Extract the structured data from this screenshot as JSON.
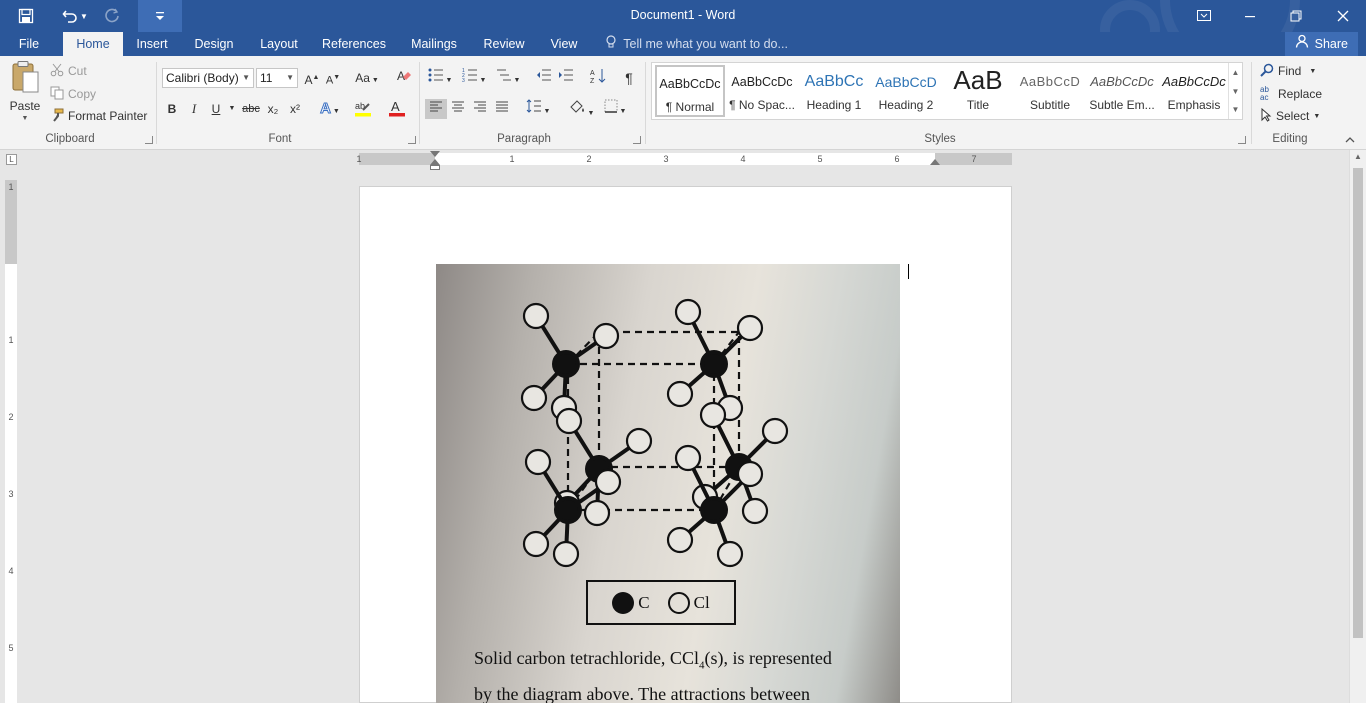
{
  "title_bar": {
    "title": "Document1 - Word"
  },
  "tabs": {
    "file": "File",
    "items": [
      "Home",
      "Insert",
      "Design",
      "Layout",
      "References",
      "Mailings",
      "Review",
      "View"
    ],
    "active": "Home",
    "tell_me": "Tell me what you want to do...",
    "share": "Share"
  },
  "clipboard": {
    "paste": "Paste",
    "cut": "Cut",
    "copy": "Copy",
    "format_painter": "Format Painter",
    "label": "Clipboard"
  },
  "font": {
    "name": "Calibri (Body)",
    "size": "11",
    "label": "Font",
    "bold": "B",
    "italic": "I",
    "underline": "U",
    "strikethrough": "abc",
    "subscript": "x₂",
    "superscript": "x²",
    "change_case": "Aa"
  },
  "paragraph": {
    "label": "Paragraph"
  },
  "styles": {
    "label": "Styles",
    "items": [
      {
        "preview": "AaBbCcDc",
        "name": "¶ Normal"
      },
      {
        "preview": "AaBbCcDc",
        "name": "¶ No Spac..."
      },
      {
        "preview": "AaBbCc",
        "name": "Heading 1"
      },
      {
        "preview": "AaBbCcD",
        "name": "Heading 2"
      },
      {
        "preview": "AaB",
        "name": "Title"
      },
      {
        "preview": "AaBbCcD",
        "name": "Subtitle"
      },
      {
        "preview": "AaBbCcDc",
        "name": "Subtle Em..."
      },
      {
        "preview": "AaBbCcDc",
        "name": "Emphasis"
      }
    ]
  },
  "editing": {
    "find": "Find",
    "replace": "Replace",
    "select": "Select",
    "label": "Editing"
  },
  "ruler": {
    "h_numbers": [
      "1",
      "1",
      "2",
      "3",
      "4",
      "5",
      "6",
      "7"
    ],
    "v_numbers": [
      "1",
      "1",
      "2",
      "3",
      "4",
      "5"
    ]
  },
  "document": {
    "legend_c": "C",
    "legend_cl": "Cl",
    "text_line1_a": "Solid carbon tetrachloride, CCl",
    "text_line1_sub": "4",
    "text_line1_b": "(s), is represented",
    "text_line2": "by the diagram above. The attractions between"
  },
  "colors": {
    "accent": "#2b579a",
    "ribbon": "#f3f3f3",
    "workspace": "#e6e6e6"
  }
}
